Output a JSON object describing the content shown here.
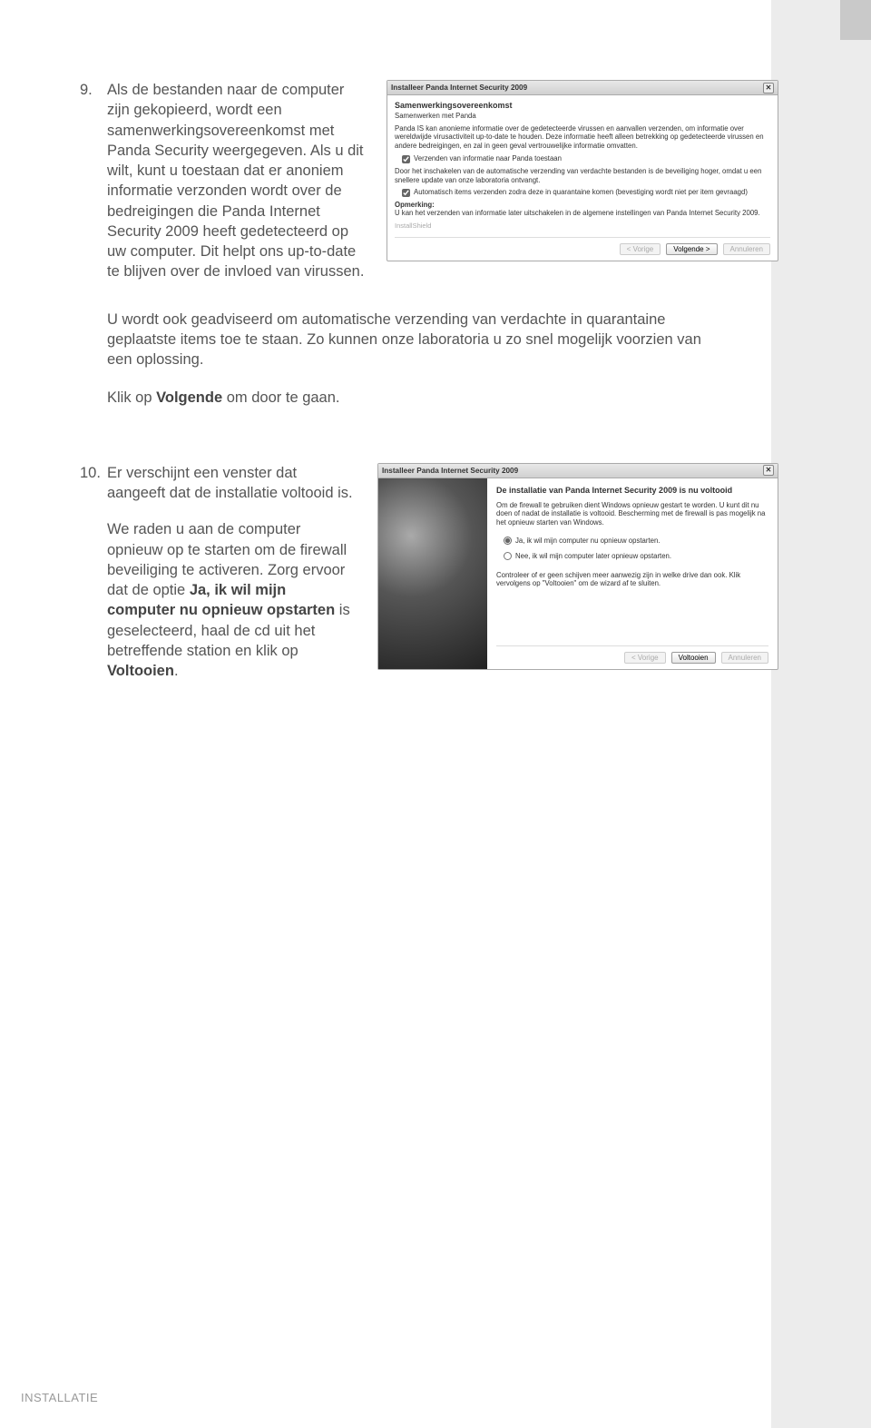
{
  "footer": "INSTALLATIE",
  "step9": {
    "num": "9.",
    "p1": "Als de bestanden naar de computer zijn gekopieerd, wordt een samenwerkingsovereenkomst met Panda Security weergegeven. Als u dit wilt, kunt u toestaan dat er anoniem informatie verzonden wordt over de bedreigingen die Panda Internet Security 2009 heeft gedetecteerd op uw computer. Dit helpt ons up-to-date te blijven over de invloed van virussen.",
    "p2": "U wordt ook geadviseerd om automatische verzending van verdachte in quarantaine geplaatste items toe te staan. Zo kunnen onze laboratoria u zo snel mogelijk voorzien van een oplossing.",
    "p3_pre": "Klik op ",
    "p3_bold": "Volgende",
    "p3_post": " om door te gaan."
  },
  "win9": {
    "title": "Installeer Panda Internet Security 2009",
    "heading": "Samenwerkingsovereenkomst",
    "sub": "Samenwerken met Panda",
    "desc": "Panda IS kan anonieme informatie over de gedetecteerde virussen en aanvallen verzenden, om informatie over wereldwijde virusactiviteit up-to-date te houden. Deze informatie heeft alleen betrekking op gedetecteerde virussen en andere bedreigingen, en zal in geen geval vertrouwelijke informatie omvatten.",
    "cb1": "Verzenden van informatie naar Panda toestaan",
    "desc2": "Door het inschakelen van de automatische verzending van verdachte bestanden is de beveiliging hoger, omdat u een snellere update van onze laboratoria ontvangt.",
    "cb2": "Automatisch items verzenden zodra deze in quarantaine komen (bevestiging wordt niet per item gevraagd)",
    "note_label": "Opmerking:",
    "note": "U kan het verzenden van informatie later uitschakelen in de algemene instellingen van Panda Internet Security 2009.",
    "brand": "InstallShield",
    "btn_prev": "< Vorige",
    "btn_next": "Volgende >",
    "btn_cancel": "Annuleren"
  },
  "step10": {
    "num": "10.",
    "p1": "Er verschijnt een venster dat aangeeft dat de installatie voltooid is.",
    "p2_pre": "We raden u aan de computer opnieuw op te starten om de firewall beveiliging te activeren. Zorg ervoor dat de optie ",
    "p2_b1": "Ja, ik wil mijn computer nu opnieuw opstarten",
    "p2_mid": " is geselecteerd, haal de cd uit het betreffende station en klik op ",
    "p2_b2": "Voltooien",
    "p2_post": "."
  },
  "win10": {
    "title": "Installeer Panda Internet Security 2009",
    "heading": "De installatie van Panda Internet Security 2009 is nu voltooid",
    "desc": "Om de firewall te gebruiken dient Windows opnieuw gestart te worden. U kunt dit nu doen of nadat de installatie is voltooid. Bescherming met de firewall is pas mogelijk na het opnieuw starten van Windows.",
    "r1": "Ja, ik wil mijn computer nu opnieuw opstarten.",
    "r2": "Nee, ik wil mijn computer later opnieuw opstarten.",
    "desc2": "Controleer of er geen schijven meer aanwezig zijn in welke drive dan ook. Klik vervolgens op \"Voltooien\" om de wizard af te sluiten.",
    "btn_prev": "< Vorige",
    "btn_finish": "Voltooien",
    "btn_cancel": "Annuleren"
  }
}
